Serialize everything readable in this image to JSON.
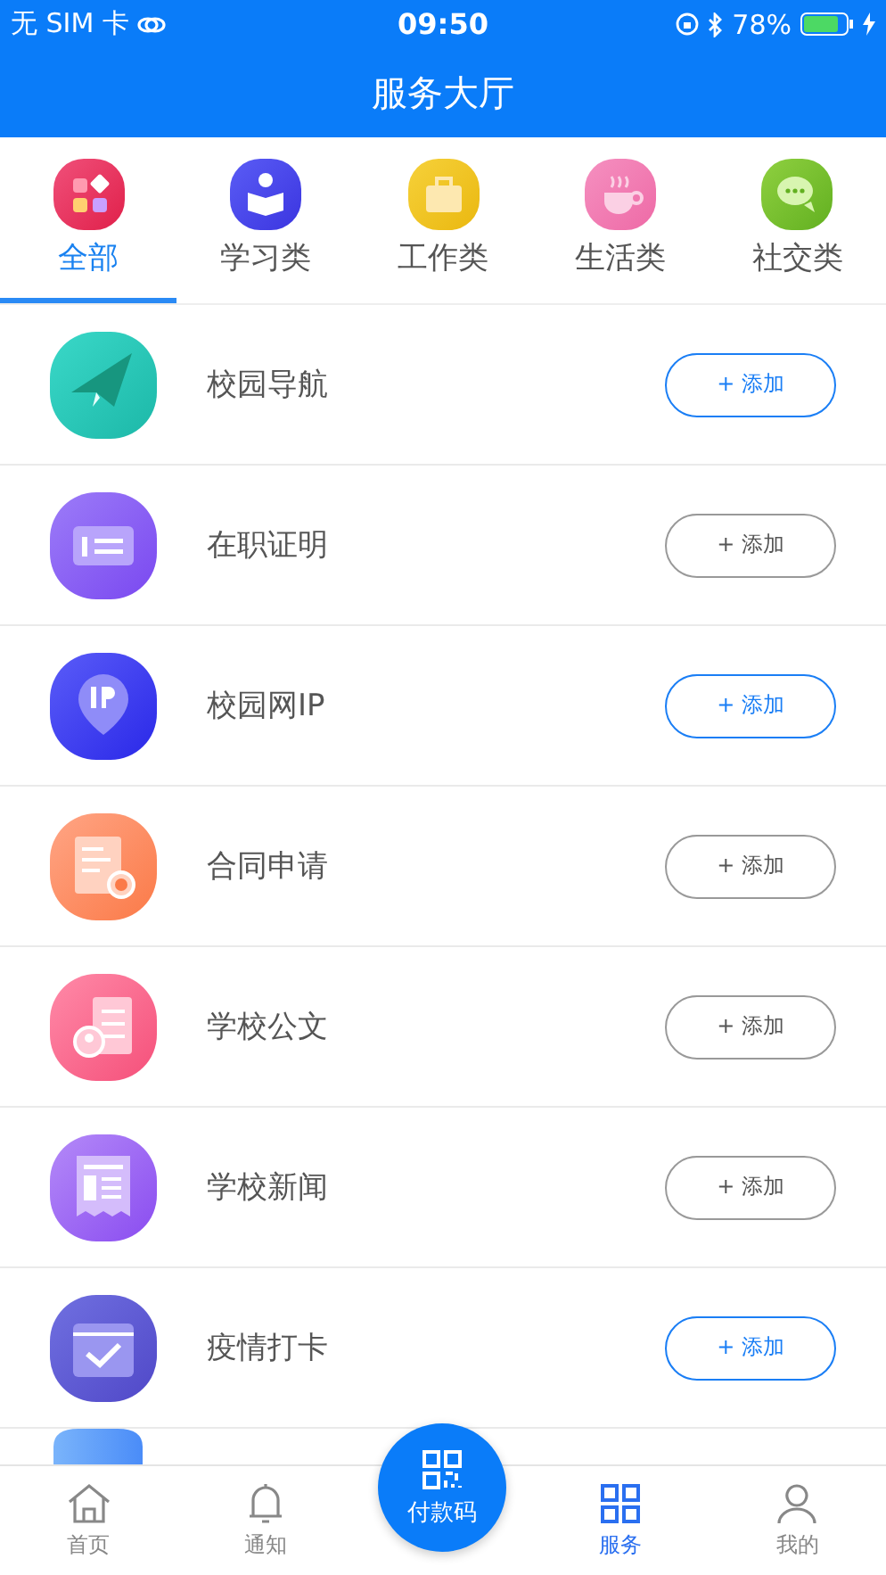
{
  "status_bar": {
    "carrier": "无 SIM 卡",
    "time": "09:50",
    "battery": "78%"
  },
  "header": {
    "title": "服务大厅"
  },
  "tabs": [
    {
      "label": "全部",
      "kind": "grid",
      "selected": true
    },
    {
      "label": "学习类",
      "kind": "reader",
      "selected": false
    },
    {
      "label": "工作类",
      "kind": "briefcase",
      "selected": false
    },
    {
      "label": "生活类",
      "kind": "cup",
      "selected": false
    },
    {
      "label": "社交类",
      "kind": "chat",
      "selected": false
    }
  ],
  "services": [
    {
      "name": "校园导航",
      "kind": "plane",
      "button": "+ 添加",
      "highlighted": true
    },
    {
      "name": "在职证明",
      "kind": "idcard",
      "button": "+ 添加",
      "highlighted": false
    },
    {
      "name": "校园网IP",
      "kind": "pin",
      "button": "+ 添加",
      "highlighted": true
    },
    {
      "name": "合同申请",
      "kind": "contract",
      "button": "+ 添加",
      "highlighted": false
    },
    {
      "name": "学校公文",
      "kind": "document",
      "button": "+ 添加",
      "highlighted": false
    },
    {
      "name": "学校新闻",
      "kind": "news",
      "button": "+ 添加",
      "highlighted": false
    },
    {
      "name": "疫情打卡",
      "kind": "calendar",
      "button": "+ 添加",
      "highlighted": true
    }
  ],
  "fab": {
    "label": "付款码"
  },
  "tab_bar": [
    {
      "label": "首页",
      "kind": "home",
      "selected": false
    },
    {
      "label": "通知",
      "kind": "bell",
      "selected": false
    },
    {
      "label": "服务",
      "kind": "apps",
      "selected": true
    },
    {
      "label": "我的",
      "kind": "person",
      "selected": false
    }
  ]
}
